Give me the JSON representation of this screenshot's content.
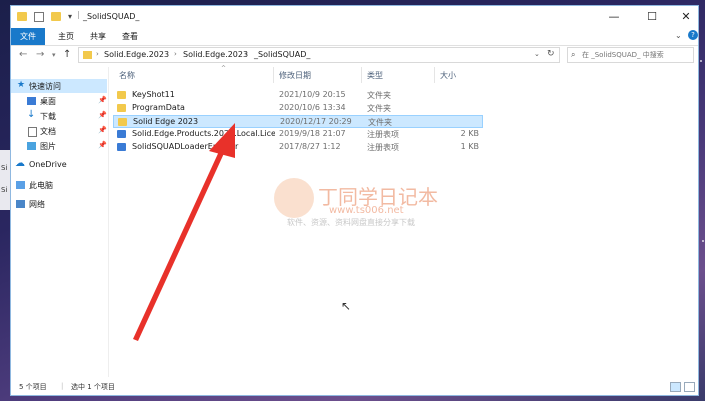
{
  "window": {
    "title": "_SolidSQUAD_"
  },
  "ribbon": {
    "tabs": [
      "文件",
      "主页",
      "共享",
      "查看"
    ]
  },
  "address": {
    "crumbs": [
      "Solid.Edge.2023",
      "Solid.Edge.2023",
      "_SolidSQUAD_"
    ]
  },
  "search": {
    "placeholder": "在 _SolidSQUAD_ 中搜索"
  },
  "sidebar": {
    "quick_access": "快速访问",
    "items": [
      {
        "label": "桌面"
      },
      {
        "label": "下载"
      },
      {
        "label": "文档"
      },
      {
        "label": "图片"
      }
    ],
    "onedrive": "OneDrive",
    "this_pc": "此电脑",
    "network": "网络"
  },
  "columns": {
    "name": "名称",
    "date": "修改日期",
    "type": "类型",
    "size": "大小"
  },
  "files": [
    {
      "name": "KeyShot11",
      "date": "2021/10/9 20:15",
      "type": "文件夹",
      "size": "",
      "icon": "folder-icon"
    },
    {
      "name": "ProgramData",
      "date": "2020/10/6 13:34",
      "type": "文件夹",
      "size": "",
      "icon": "folder-icon"
    },
    {
      "name": "Solid Edge 2023",
      "date": "2020/12/17 20:29",
      "type": "文件夹",
      "size": "",
      "icon": "folder-icon"
    },
    {
      "name": "Solid.Edge.Products.2023.Local.Licen...",
      "date": "2019/9/18 21:07",
      "type": "注册表项",
      "size": "2 KB",
      "icon": "registry-icon"
    },
    {
      "name": "SolidSQUADLoaderEnabler",
      "date": "2017/8/27 1:12",
      "type": "注册表项",
      "size": "1 KB",
      "icon": "registry-icon"
    }
  ],
  "watermark": {
    "title": "丁同学日记本",
    "url": "www.ts006.net",
    "subtitle": "软件、资源、资料网盘直接分享下载"
  },
  "status": {
    "count": "5 个项目",
    "selected": "选中 1 个项目"
  },
  "colors": {
    "accent": "#1979ca",
    "selection": "#cce8ff",
    "arrow": "#e8312a"
  }
}
